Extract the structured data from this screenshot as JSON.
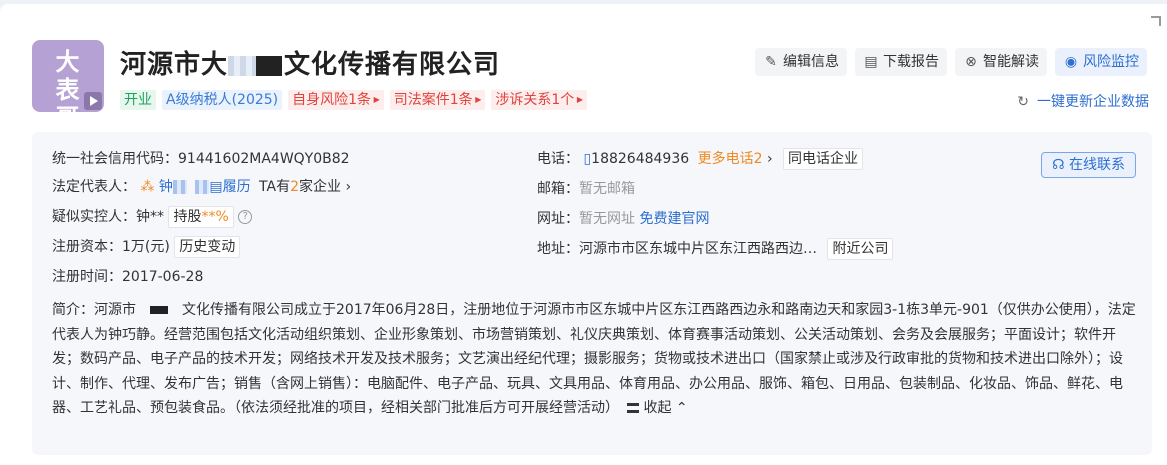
{
  "logo": {
    "text": "大表哥"
  },
  "company": {
    "name_prefix": "河源市大",
    "name_suffix": "文化传播有限公司"
  },
  "tags": [
    {
      "label": "开业",
      "color": "green"
    },
    {
      "label": "A级纳税人(2025)",
      "color": "blue"
    },
    {
      "label": "自身风险1条",
      "color": "red"
    },
    {
      "label": "司法案件1条",
      "color": "red"
    },
    {
      "label": "涉诉关系1个",
      "color": "red"
    }
  ],
  "actions": {
    "edit": "编辑信息",
    "download": "下载报告",
    "ai": "智能解读",
    "monitor": "风险监控"
  },
  "refresh": "一键更新企业数据",
  "info": {
    "credit_code_label": "统一社会信用代码：",
    "credit_code": "91441602MA4WQY0B82",
    "legal_rep_label": "法定代表人：",
    "legal_rep_name": "钟",
    "resume": "履历",
    "ta_prefix": "TA有",
    "ta_count": "2",
    "ta_suffix": "家企业",
    "controller_label": "疑似实控人：",
    "controller_name": "钟**",
    "share_label": "持股",
    "share_value": "**%",
    "capital_label": "注册资本：",
    "capital": "1万(元)",
    "history": "历史变动",
    "date_label": "注册时间：",
    "date": "2017-06-28",
    "phone_label": "电话：",
    "phone": "18826484936",
    "more_phone": "更多电话2",
    "same_phone": "同电话企业",
    "email_label": "邮箱：",
    "email": "暂无邮箱",
    "site_label": "网址：",
    "site": "暂无网址",
    "site_free": "免费建官网",
    "addr_label": "地址：",
    "addr": "河源市市区东城中片区东江西路西边…",
    "nearby": "附近公司",
    "online": "在线联系",
    "intro_label": "简介：",
    "intro_prefix": "河源市",
    "intro_body": "文化传播有限公司成立于2017年06月28日，注册地位于河源市市区东城中片区东江西路西边永和路南边天和家园3-1栋3单元-901（仅供办公使用），法定代表人为钟巧静。经营范围包括文化活动组织策划、企业形象策划、市场营销策划、礼仪庆典策划、体育赛事活动策划、公关活动策划、会务及会展服务；平面设计；软件开发；数码产品、电子产品的技术开发；网络技术开发及技术服务；文艺演出经纪代理；摄影服务；货物或技术进出口（国家禁止或涉及行政审批的货物和技术进出口除外）；设计、制作、代理、发布广告；销售（含网上销售）：电脑配件、电子产品、玩具、文具用品、体育用品、办公用品、服饰、箱包、日用品、包装制品、化妆品、饰品、鲜花、电器、工艺礼品、预包装食品。（依法须经批准的项目，经相关部门批准后方可开展经营活动）",
    "collapse": "收起"
  }
}
